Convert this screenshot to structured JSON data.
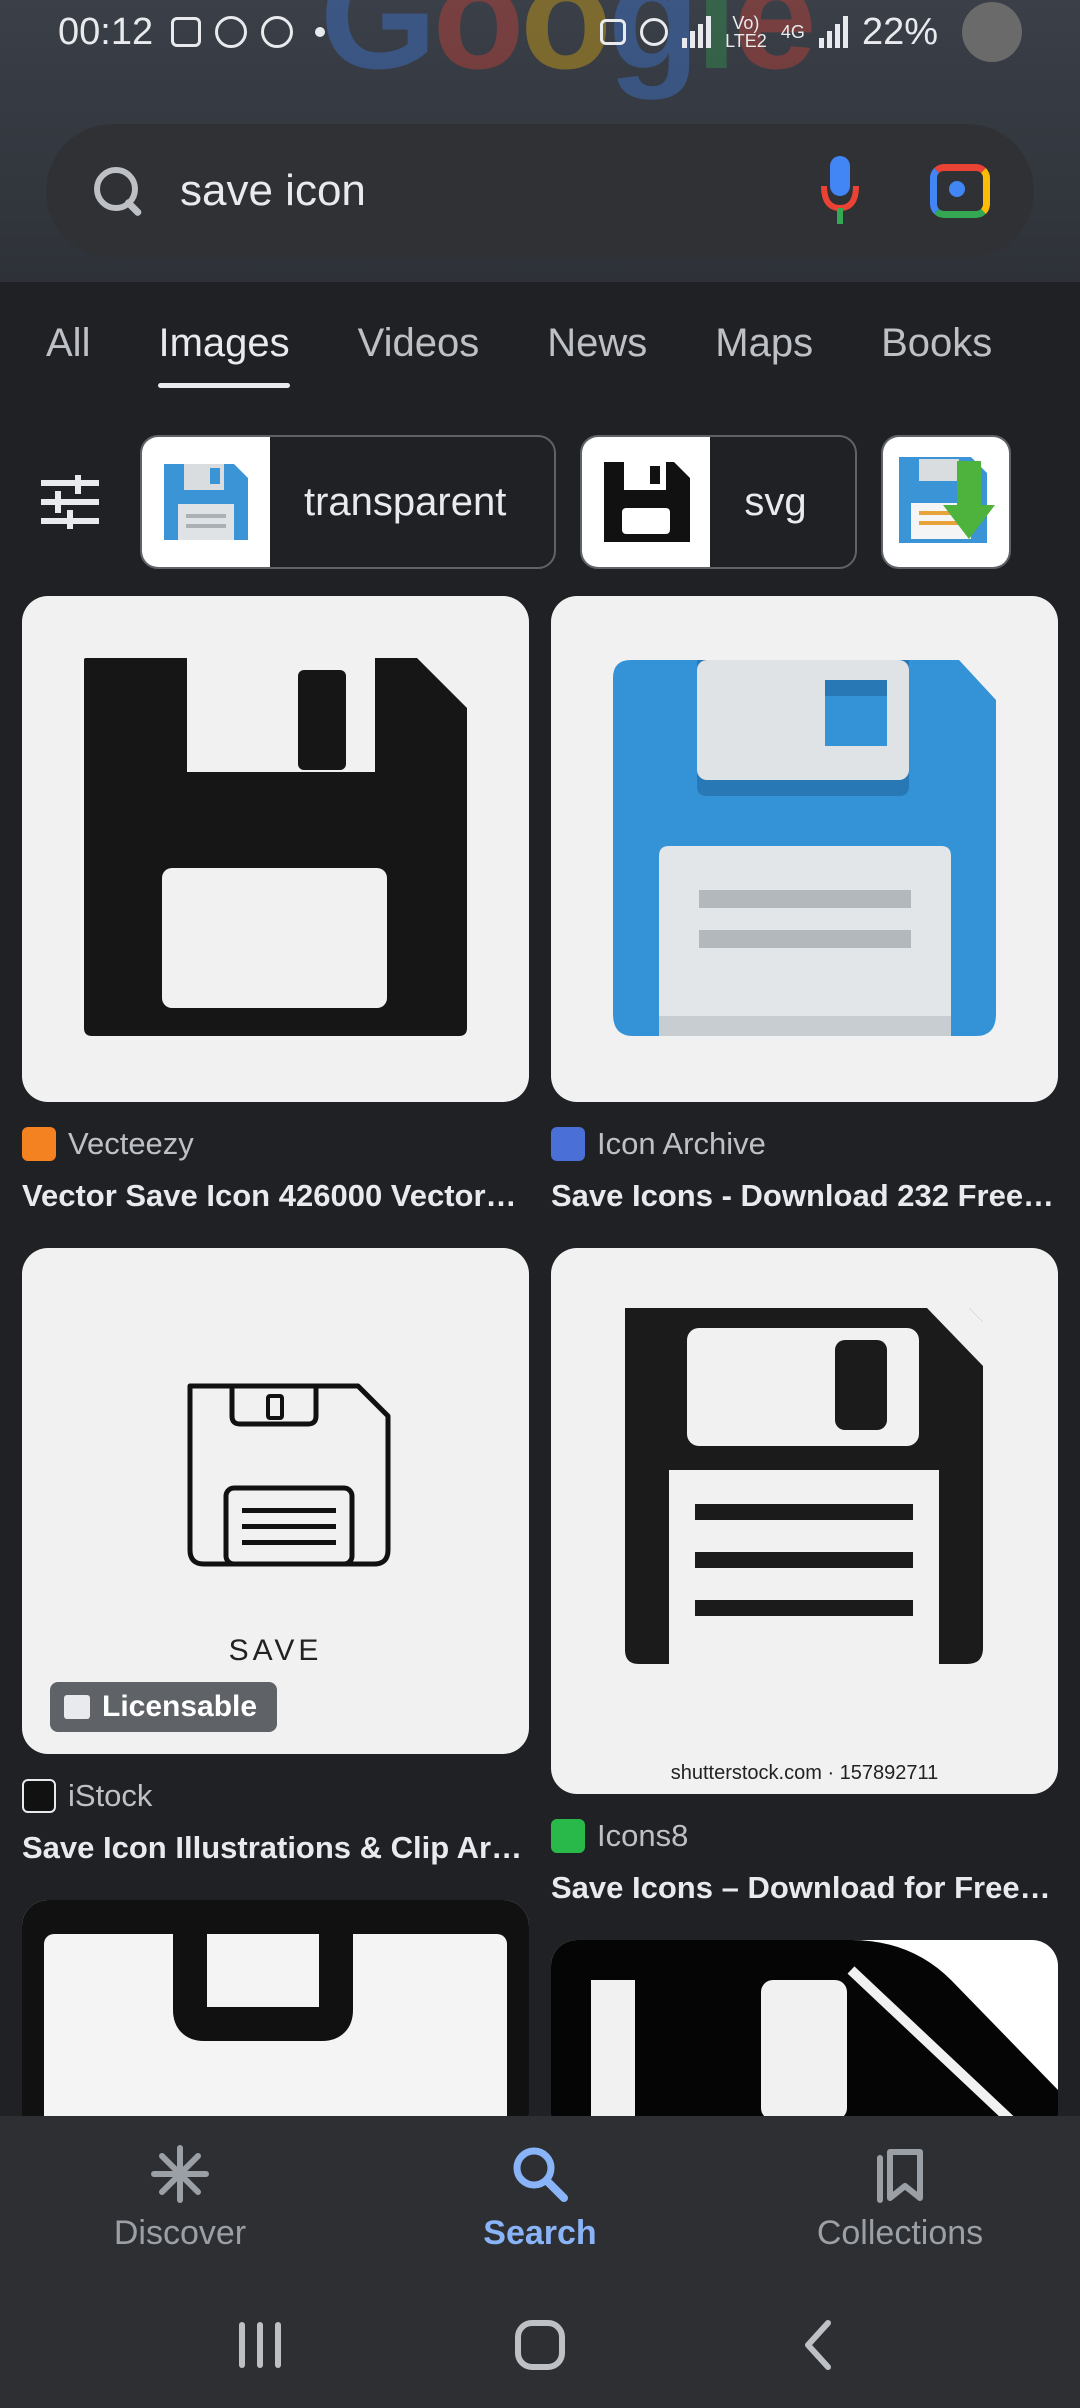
{
  "status_bar": {
    "time": "00:12",
    "network_label": "Vo) LTE2",
    "network_type": "4G",
    "battery": "22%"
  },
  "search": {
    "query": "save icon"
  },
  "tabs": [
    {
      "label": "All"
    },
    {
      "label": "Images",
      "active": true
    },
    {
      "label": "Videos"
    },
    {
      "label": "News"
    },
    {
      "label": "Maps"
    },
    {
      "label": "Books"
    }
  ],
  "chips": [
    {
      "label": "transparent"
    },
    {
      "label": "svg"
    }
  ],
  "results": [
    {
      "source": "Vecteezy",
      "title": "Vector Save Icon 426000 Vector…"
    },
    {
      "source": "Icon Archive",
      "title": "Save Icons - Download 232 Free…"
    },
    {
      "source": "iStock",
      "title": "Save Icon Illustrations & Clip Ar…",
      "badge": "Licensable",
      "image_text": "SAVE"
    },
    {
      "source": "Icons8",
      "title": "Save Icons – Download for Free…",
      "image_text": "shutterstock.com · 157892711"
    }
  ],
  "bottom_nav": {
    "discover": "Discover",
    "search": "Search",
    "collections": "Collections"
  },
  "colors": {
    "accent": "#8ab4f8",
    "background": "#202124"
  }
}
